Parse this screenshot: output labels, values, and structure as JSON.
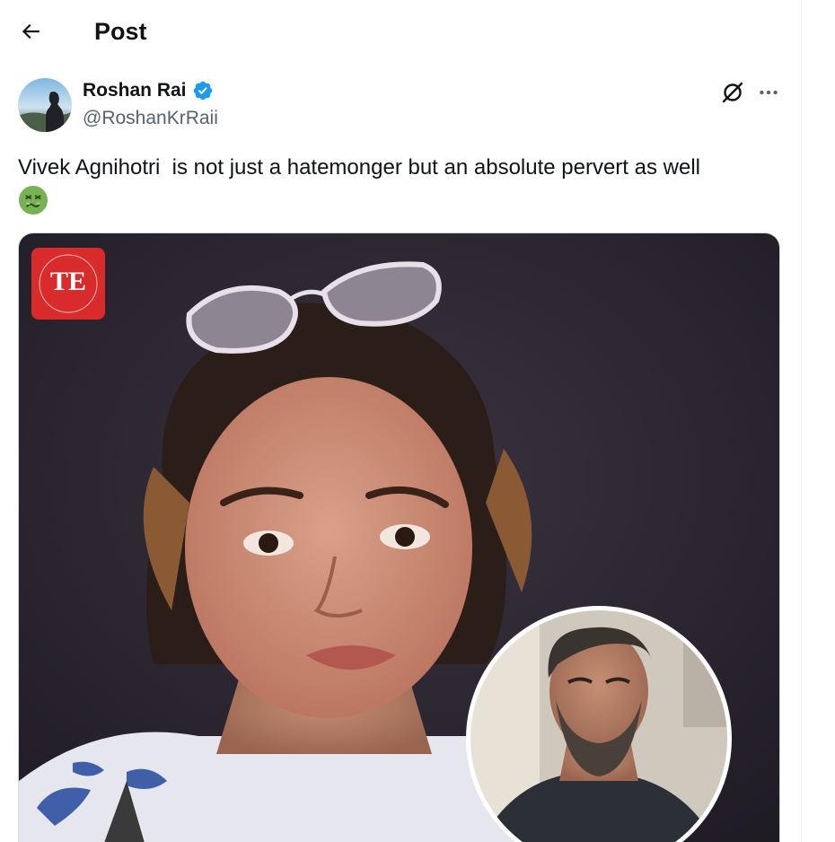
{
  "header": {
    "title": "Post",
    "back_icon": "arrow-left-icon"
  },
  "tweet": {
    "author": {
      "display_name": "Roshan Rai",
      "handle": "@RoshanKrRaii",
      "verified": true,
      "verified_color": "#1d9bf0"
    },
    "text": "Vivek Agnihotri  is not just a hatemonger but an absolute pervert as well",
    "emoji": "nauseated-face",
    "media": {
      "logo_text": "TE",
      "logo_color": "#d92b2b"
    }
  },
  "icons": {
    "grok": "grok-icon",
    "more": "more-icon"
  },
  "colors": {
    "text": "#0f1419",
    "secondary": "#536471",
    "accent": "#1d9bf0"
  }
}
